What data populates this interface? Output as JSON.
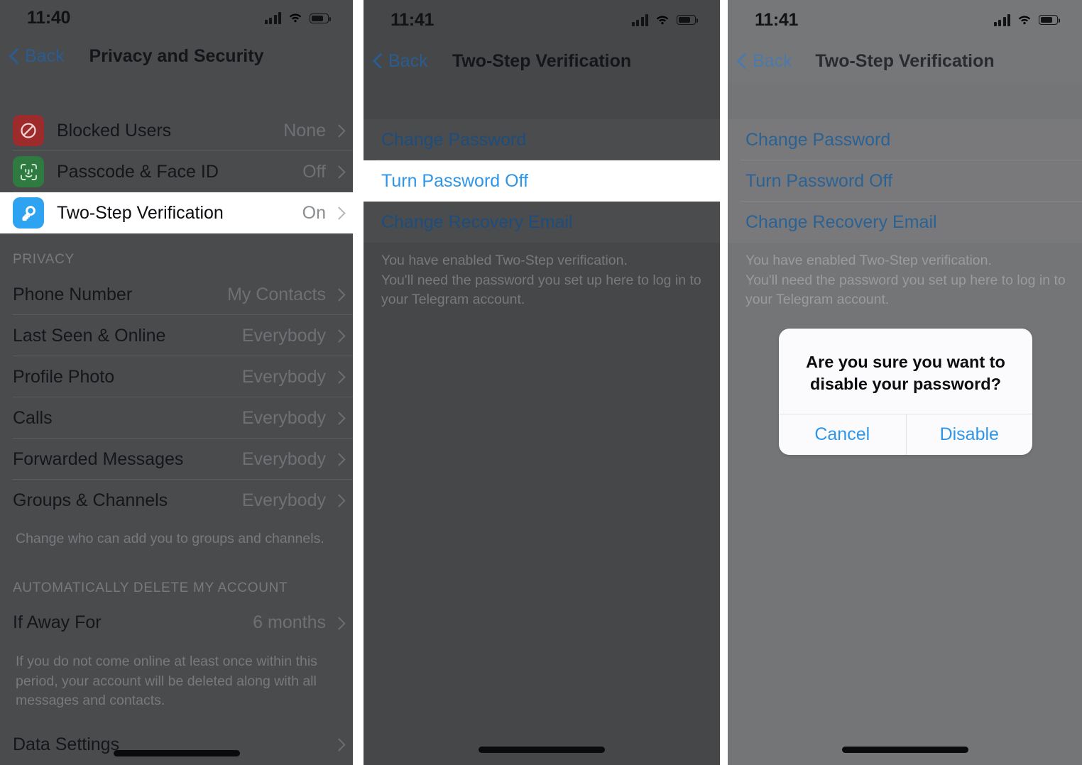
{
  "panels": [
    {
      "id": "privacy-and-security",
      "status": {
        "time": "11:40",
        "signal_icon": "cellular-bars-icon",
        "wifi_icon": "wifi-icon",
        "battery_icon": "battery-icon"
      },
      "nav": {
        "back_label": "Back",
        "title": "Privacy and Security",
        "back_icon": "chevron-left-icon"
      },
      "security_rows": [
        {
          "icon": "blocked-users-icon",
          "label": "Blocked Users",
          "value": "None",
          "highlighted": false
        },
        {
          "icon": "face-id-icon",
          "label": "Passcode & Face ID",
          "value": "Off",
          "highlighted": false
        },
        {
          "icon": "key-icon",
          "label": "Two-Step Verification",
          "value": "On",
          "highlighted": true
        }
      ],
      "privacy_section_header": "PRIVACY",
      "privacy_rows": [
        {
          "label": "Phone Number",
          "value": "My Contacts"
        },
        {
          "label": "Last Seen & Online",
          "value": "Everybody"
        },
        {
          "label": "Profile Photo",
          "value": "Everybody"
        },
        {
          "label": "Calls",
          "value": "Everybody"
        },
        {
          "label": "Forwarded Messages",
          "value": "Everybody"
        },
        {
          "label": "Groups & Channels",
          "value": "Everybody"
        }
      ],
      "privacy_footer": "Change who can add you to groups and channels.",
      "delete_section_header": "AUTOMATICALLY DELETE MY ACCOUNT",
      "delete_rows": [
        {
          "label": "If Away For",
          "value": "6 months"
        }
      ],
      "delete_footer": "If you do not come online at least once within this period, your account will be deleted along with all messages and contacts.",
      "last_row": {
        "label": "Data Settings",
        "value": ""
      }
    },
    {
      "id": "two-step-verification-highlight",
      "status": {
        "time": "11:41",
        "signal_icon": "cellular-bars-icon",
        "wifi_icon": "wifi-icon",
        "battery_icon": "battery-icon"
      },
      "nav": {
        "back_label": "Back",
        "title": "Two-Step Verification",
        "back_icon": "chevron-left-icon"
      },
      "links": [
        {
          "label": "Change Password",
          "highlighted": false
        },
        {
          "label": "Turn Password Off",
          "highlighted": true
        },
        {
          "label": "Change Recovery Email",
          "highlighted": false
        }
      ],
      "footer": "You have enabled Two-Step verification.\nYou'll need the password you set up here to log in to your Telegram account."
    },
    {
      "id": "two-step-verification-dialog",
      "status": {
        "time": "11:41",
        "signal_icon": "cellular-bars-icon",
        "wifi_icon": "wifi-icon",
        "battery_icon": "battery-icon"
      },
      "nav": {
        "back_label": "Back",
        "title": "Two-Step Verification",
        "back_icon": "chevron-left-icon"
      },
      "links": [
        {
          "label": "Change Password",
          "highlighted": false
        },
        {
          "label": "Turn Password Off",
          "highlighted": false
        },
        {
          "label": "Change Recovery Email",
          "highlighted": false
        }
      ],
      "footer": "You have enabled Two-Step verification.\nYou'll need the password you set up here to log in to your Telegram account.",
      "dialog": {
        "title": "Are you sure you want to disable your password?",
        "cancel_label": "Cancel",
        "confirm_label": "Disable"
      }
    }
  ],
  "colors": {
    "ios_blue": "#2e96e8",
    "blocked_red": "#d93b3b",
    "face_id_green": "#3ca557",
    "key_blue": "#2ea3f2"
  }
}
